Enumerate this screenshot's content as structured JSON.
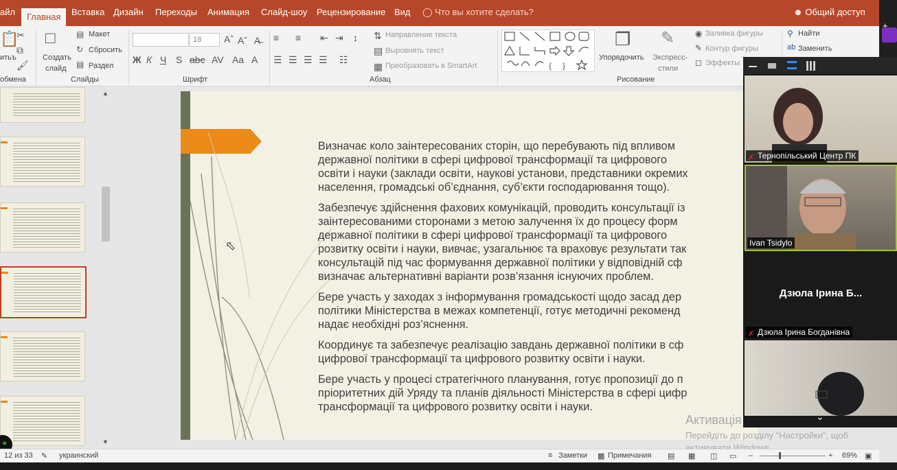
{
  "tabs": [
    "айл",
    "Главная",
    "Вставка",
    "Дизайн",
    "Переходы",
    "Анимация",
    "Слайд-шоу",
    "Рецензирование",
    "Вид"
  ],
  "active_tab": "Главная",
  "tell_me": "Что вы хотите сделать?",
  "share": "Общий доступ",
  "ribbon": {
    "paste": "итьъ",
    "create_slide": "Создать",
    "create_slide2": "слайд",
    "layout": "Макет",
    "reset": "Сбросить",
    "section": "Раздел",
    "font_size": "18",
    "text_direction": "Направление текста",
    "align_text": "Выровнять текст",
    "smartart": "Преобразовать в SmartArt",
    "arrange": "Упорядочить",
    "quick_styles": "Экспресс-",
    "quick_styles2": "стили",
    "shape_fill": "Заливка фигуры",
    "shape_outline": "Контур фигуры",
    "effects": "Эффекты",
    "find": "Найти",
    "replace": "Заменить",
    "groups": {
      "clipboard": "обмена",
      "slides": "Слайды",
      "font": "Шрифт",
      "paragraph": "Абзац",
      "drawing": "Рисование"
    }
  },
  "slide": {
    "bullets": [
      [
        "Визначає коло заінтересованих сторін, що перебувають під впливом",
        "державної політики в сфері цифрової трансформації та цифрового",
        "освіти і науки (заклади освіти, наукові установи, представники окремих",
        "населення, громадські об’єднання, суб’єкти господарювання тощо)."
      ],
      [
        "Забезпечує здійснення фахових комунікацій, проводить консультації із",
        "заінтересованими сторонами з метою залучення їх до процесу форм",
        "державної політики в сфері цифрової трансформації та цифрового",
        "розвитку  освіти і науки, вивчає, узагальнює та враховує результати так",
        "консультацій під час формування державної політики у відповідній сф",
        "визначає альтернативні варіанти розв’язання існуючих проблем."
      ],
      [
        "Бере участь у заходах з інформування громадськості щодо засад дер",
        "політики Міністерства в межах компетенції, готує методичні рекоменд",
        "надає необхідні роз’яснення."
      ],
      [
        "Координує та забезпечує реалізацію завдань державної політики в сф",
        "цифрової трансформації та цифрового розвитку освіти і науки."
      ],
      [
        "Бере участь у процесі стратегічного планування, готує пропозиції до п",
        "пріоритетних дій Уряду та планів діяльності Міністерства в сфері цифр",
        "трансформації та цифрового розвитку освіти і науки."
      ]
    ]
  },
  "watermark": {
    "title": "Активація Windows",
    "line1": "Перейдіть до розділу \"Настройки\", щоб",
    "line2": "активувати Windows."
  },
  "status": {
    "slide_counter": "12 из 33",
    "language": "украинский",
    "notes": "Заметки",
    "comments": "Примечания",
    "zoom": "69%"
  },
  "zoom_panel": {
    "participants": [
      {
        "name": "Тернопільський Центр ПК",
        "muted": true
      },
      {
        "name": "Ivan Tsidylo",
        "muted": false
      },
      {
        "name": "Дзюла Ірина Богданівна",
        "muted": true,
        "display": "Дзюла Ірина Б..."
      },
      {
        "name": "",
        "muted": false
      }
    ]
  },
  "colors": {
    "accent": "#b7472a",
    "slide_orange": "#ec8a1a",
    "slide_bar": "#6b7356"
  }
}
